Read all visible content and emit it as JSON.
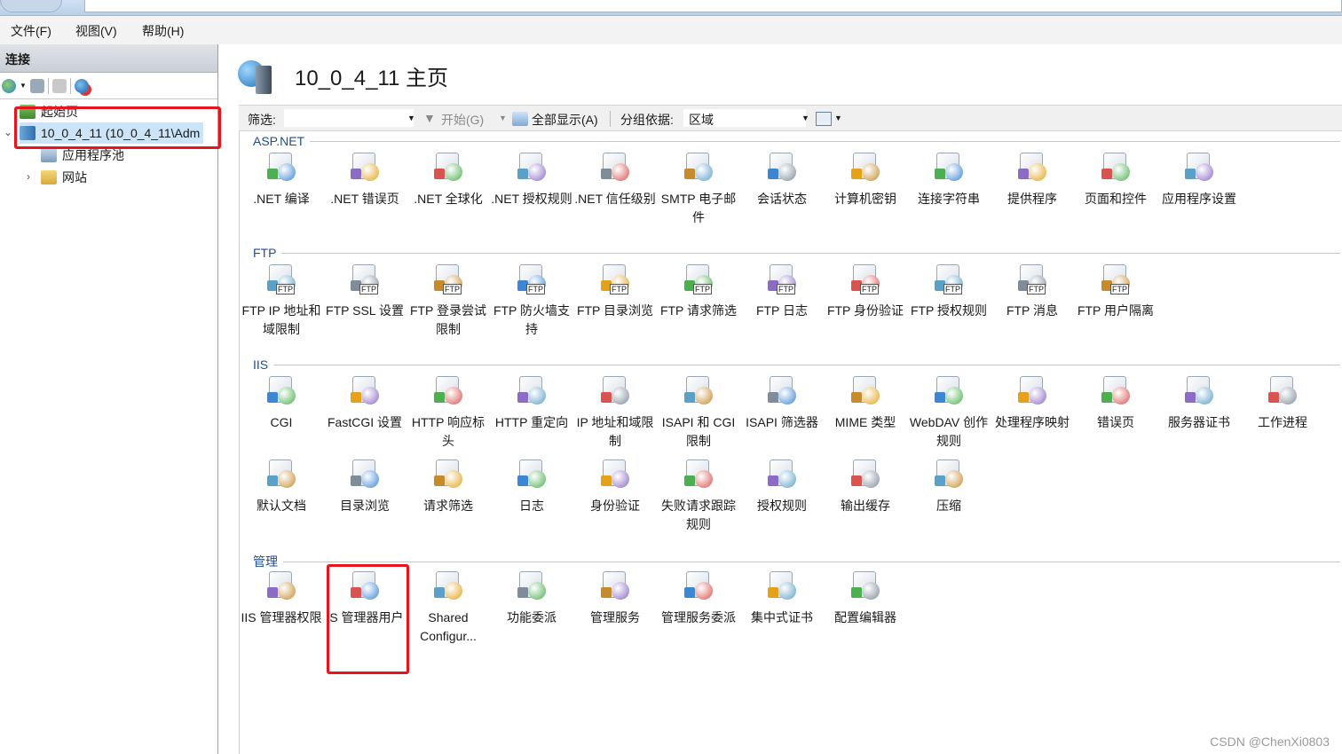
{
  "menu": {
    "file": "文件(F)",
    "view": "视图(V)",
    "help": "帮助(H)"
  },
  "connections": {
    "header": "连接",
    "tree": {
      "start_page": "起始页",
      "server": "10_0_4_11 (10_0_4_11\\Adm",
      "app_pools": "应用程序池",
      "sites": "网站"
    }
  },
  "main": {
    "title": "10_0_4_11 主页",
    "filter": {
      "label": "筛选:",
      "value": "",
      "start": "开始(G)",
      "show_all": "全部显示(A)",
      "group_by_label": "分组依据:",
      "group_by_value": "区域"
    },
    "groups": [
      {
        "name": "ASP.NET",
        "items": [
          {
            "label": ".NET 编译",
            "icon": "dotnet-compile-icon"
          },
          {
            "label": ".NET 错误页",
            "icon": "dotnet-error-page-icon"
          },
          {
            "label": ".NET 全球化",
            "icon": "globe-icon"
          },
          {
            "label": ".NET 授权规则",
            "icon": "auth-rules-icon"
          },
          {
            "label": ".NET 信任级别",
            "icon": "trust-level-icon"
          },
          {
            "label": "SMTP 电子邮件",
            "icon": "smtp-email-icon"
          },
          {
            "label": "会话状态",
            "icon": "session-state-icon"
          },
          {
            "label": "计算机密钥",
            "icon": "machine-key-icon"
          },
          {
            "label": "连接字符串",
            "icon": "connection-string-icon"
          },
          {
            "label": "提供程序",
            "icon": "providers-icon"
          },
          {
            "label": "页面和控件",
            "icon": "pages-controls-icon"
          },
          {
            "label": "应用程序设置",
            "icon": "app-settings-icon"
          }
        ]
      },
      {
        "name": "FTP",
        "items": [
          {
            "label": "FTP IP 地址和域限制",
            "icon": "ftp-ip-icon"
          },
          {
            "label": "FTP SSL 设置",
            "icon": "ftp-ssl-icon"
          },
          {
            "label": "FTP 登录尝试限制",
            "icon": "ftp-logon-icon"
          },
          {
            "label": "FTP 防火墙支持",
            "icon": "ftp-firewall-icon"
          },
          {
            "label": "FTP 目录浏览",
            "icon": "ftp-dir-browse-icon"
          },
          {
            "label": "FTP 请求筛选",
            "icon": "ftp-request-filter-icon"
          },
          {
            "label": "FTP 日志",
            "icon": "ftp-log-icon"
          },
          {
            "label": "FTP 身份验证",
            "icon": "ftp-auth-icon"
          },
          {
            "label": "FTP 授权规则",
            "icon": "ftp-authz-icon"
          },
          {
            "label": "FTP 消息",
            "icon": "ftp-messages-icon"
          },
          {
            "label": "FTP 用户隔离",
            "icon": "ftp-user-isolation-icon"
          }
        ]
      },
      {
        "name": "IIS",
        "items": [
          {
            "label": "CGI",
            "icon": "cgi-icon"
          },
          {
            "label": "FastCGI 设置",
            "icon": "fastcgi-icon"
          },
          {
            "label": "HTTP 响应标头",
            "icon": "http-headers-icon"
          },
          {
            "label": "HTTP 重定向",
            "icon": "http-redirect-icon"
          },
          {
            "label": "IP 地址和域限制",
            "icon": "ip-restrict-icon"
          },
          {
            "label": "ISAPI 和 CGI 限制",
            "icon": "isapi-cgi-icon"
          },
          {
            "label": "ISAPI 筛选器",
            "icon": "isapi-filter-icon"
          },
          {
            "label": "MIME 类型",
            "icon": "mime-icon"
          },
          {
            "label": "WebDAV 创作规则",
            "icon": "webdav-icon"
          },
          {
            "label": "处理程序映射",
            "icon": "handler-mapping-icon"
          },
          {
            "label": "错误页",
            "icon": "error-page-icon"
          },
          {
            "label": "服务器证书",
            "icon": "server-cert-icon"
          },
          {
            "label": "工作进程",
            "icon": "worker-process-icon"
          },
          {
            "label": "默认文档",
            "icon": "default-doc-icon"
          },
          {
            "label": "目录浏览",
            "icon": "dir-browse-icon"
          },
          {
            "label": "请求筛选",
            "icon": "request-filter-icon"
          },
          {
            "label": "日志",
            "icon": "log-icon"
          },
          {
            "label": "身份验证",
            "icon": "authentication-icon"
          },
          {
            "label": "失败请求跟踪规则",
            "icon": "failed-request-icon"
          },
          {
            "label": "授权规则",
            "icon": "authorization-icon"
          },
          {
            "label": "输出缓存",
            "icon": "output-cache-icon"
          },
          {
            "label": "压缩",
            "icon": "compression-icon"
          }
        ]
      },
      {
        "name": "管理",
        "items": [
          {
            "label": "IIS 管理器权限",
            "icon": "mgr-permissions-icon"
          },
          {
            "label": "IS 管理器用户",
            "icon": "mgr-users-icon"
          },
          {
            "label": "Shared Configur...",
            "icon": "shared-config-icon"
          },
          {
            "label": "功能委派",
            "icon": "feature-delegation-icon"
          },
          {
            "label": "管理服务",
            "icon": "mgmt-service-icon"
          },
          {
            "label": "管理服务委派",
            "icon": "mgmt-delegation-icon"
          },
          {
            "label": "集中式证书",
            "icon": "central-cert-icon"
          },
          {
            "label": "配置编辑器",
            "icon": "config-editor-icon"
          }
        ]
      }
    ]
  },
  "watermark": "CSDN @ChenXi0803",
  "colors": {
    "highlight": "#e8141c",
    "group_header": "#1f4e8c"
  }
}
